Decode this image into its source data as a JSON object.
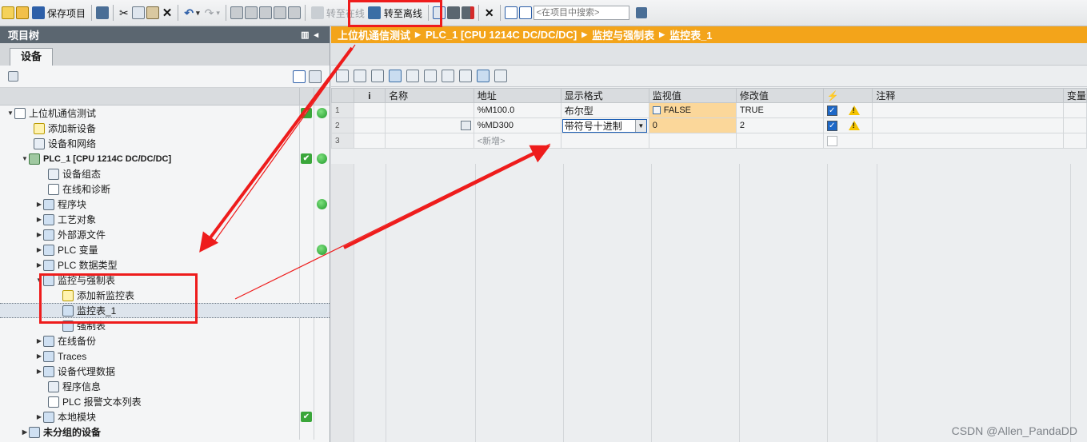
{
  "toolbar": {
    "save_project": "保存项目",
    "go_online": "转至在线",
    "go_offline": "转至离线",
    "search_placeholder": "<在项目中搜索>"
  },
  "project_tree": {
    "title": "项目树",
    "tab_devices": "设备",
    "items": [
      {
        "label": "上位机通信测试"
      },
      {
        "label": "添加新设备"
      },
      {
        "label": "设备和网络"
      },
      {
        "label": "PLC_1 [CPU 1214C DC/DC/DC]"
      },
      {
        "label": "设备组态"
      },
      {
        "label": "在线和诊断"
      },
      {
        "label": "程序块"
      },
      {
        "label": "工艺对象"
      },
      {
        "label": "外部源文件"
      },
      {
        "label": "PLC 变量"
      },
      {
        "label": "PLC 数据类型"
      },
      {
        "label": "监控与强制表"
      },
      {
        "label": "添加新监控表"
      },
      {
        "label": "监控表_1"
      },
      {
        "label": "强制表"
      },
      {
        "label": "在线备份"
      },
      {
        "label": "Traces"
      },
      {
        "label": "设备代理数据"
      },
      {
        "label": "程序信息"
      },
      {
        "label": "PLC 报警文本列表"
      },
      {
        "label": "本地模块"
      },
      {
        "label": "未分组的设备"
      }
    ]
  },
  "breadcrumb": {
    "items": [
      "上位机通信测试",
      "PLC_1 [CPU 1214C DC/DC/DC]",
      "监控与强制表",
      "监控表_1"
    ]
  },
  "watch_table": {
    "columns": [
      "i",
      "名称",
      "地址",
      "显示格式",
      "监视值",
      "修改值",
      "",
      "注释",
      "变量"
    ],
    "rows": [
      {
        "num": "1",
        "address": "%M100.0",
        "format": "布尔型",
        "monitor": "FALSE",
        "modify": "TRUE"
      },
      {
        "num": "2",
        "address": "%MD300",
        "format": "带符号十进制",
        "monitor": "0",
        "modify": "2"
      },
      {
        "num": "3",
        "address": "<新增>",
        "format": "",
        "monitor": "",
        "modify": ""
      }
    ]
  },
  "watermark": "CSDN @Allen_PandaDD",
  "colors": {
    "breadcrumb_bg": "#f3a41a",
    "monitor_cell_bg": "#fbd79a",
    "highlight_red": "#ee1c1c",
    "status_green": "#3aa63a"
  }
}
